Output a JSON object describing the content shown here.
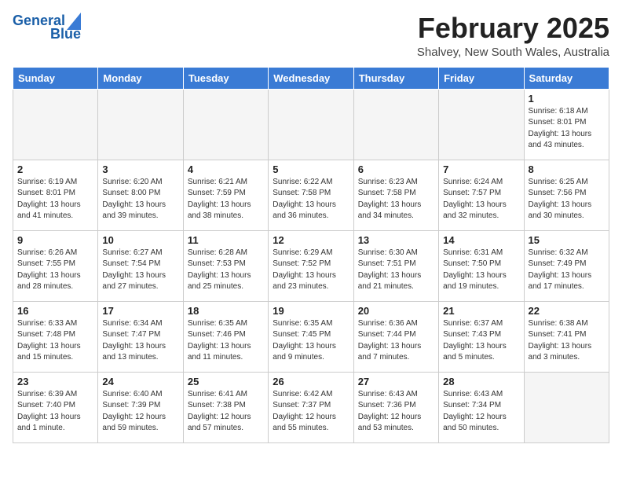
{
  "header": {
    "logo_line1": "General",
    "logo_line2": "Blue",
    "month": "February 2025",
    "location": "Shalvey, New South Wales, Australia"
  },
  "weekdays": [
    "Sunday",
    "Monday",
    "Tuesday",
    "Wednesday",
    "Thursday",
    "Friday",
    "Saturday"
  ],
  "weeks": [
    [
      {
        "day": "",
        "info": ""
      },
      {
        "day": "",
        "info": ""
      },
      {
        "day": "",
        "info": ""
      },
      {
        "day": "",
        "info": ""
      },
      {
        "day": "",
        "info": ""
      },
      {
        "day": "",
        "info": ""
      },
      {
        "day": "1",
        "info": "Sunrise: 6:18 AM\nSunset: 8:01 PM\nDaylight: 13 hours\nand 43 minutes."
      }
    ],
    [
      {
        "day": "2",
        "info": "Sunrise: 6:19 AM\nSunset: 8:01 PM\nDaylight: 13 hours\nand 41 minutes."
      },
      {
        "day": "3",
        "info": "Sunrise: 6:20 AM\nSunset: 8:00 PM\nDaylight: 13 hours\nand 39 minutes."
      },
      {
        "day": "4",
        "info": "Sunrise: 6:21 AM\nSunset: 7:59 PM\nDaylight: 13 hours\nand 38 minutes."
      },
      {
        "day": "5",
        "info": "Sunrise: 6:22 AM\nSunset: 7:58 PM\nDaylight: 13 hours\nand 36 minutes."
      },
      {
        "day": "6",
        "info": "Sunrise: 6:23 AM\nSunset: 7:58 PM\nDaylight: 13 hours\nand 34 minutes."
      },
      {
        "day": "7",
        "info": "Sunrise: 6:24 AM\nSunset: 7:57 PM\nDaylight: 13 hours\nand 32 minutes."
      },
      {
        "day": "8",
        "info": "Sunrise: 6:25 AM\nSunset: 7:56 PM\nDaylight: 13 hours\nand 30 minutes."
      }
    ],
    [
      {
        "day": "9",
        "info": "Sunrise: 6:26 AM\nSunset: 7:55 PM\nDaylight: 13 hours\nand 28 minutes."
      },
      {
        "day": "10",
        "info": "Sunrise: 6:27 AM\nSunset: 7:54 PM\nDaylight: 13 hours\nand 27 minutes."
      },
      {
        "day": "11",
        "info": "Sunrise: 6:28 AM\nSunset: 7:53 PM\nDaylight: 13 hours\nand 25 minutes."
      },
      {
        "day": "12",
        "info": "Sunrise: 6:29 AM\nSunset: 7:52 PM\nDaylight: 13 hours\nand 23 minutes."
      },
      {
        "day": "13",
        "info": "Sunrise: 6:30 AM\nSunset: 7:51 PM\nDaylight: 13 hours\nand 21 minutes."
      },
      {
        "day": "14",
        "info": "Sunrise: 6:31 AM\nSunset: 7:50 PM\nDaylight: 13 hours\nand 19 minutes."
      },
      {
        "day": "15",
        "info": "Sunrise: 6:32 AM\nSunset: 7:49 PM\nDaylight: 13 hours\nand 17 minutes."
      }
    ],
    [
      {
        "day": "16",
        "info": "Sunrise: 6:33 AM\nSunset: 7:48 PM\nDaylight: 13 hours\nand 15 minutes."
      },
      {
        "day": "17",
        "info": "Sunrise: 6:34 AM\nSunset: 7:47 PM\nDaylight: 13 hours\nand 13 minutes."
      },
      {
        "day": "18",
        "info": "Sunrise: 6:35 AM\nSunset: 7:46 PM\nDaylight: 13 hours\nand 11 minutes."
      },
      {
        "day": "19",
        "info": "Sunrise: 6:35 AM\nSunset: 7:45 PM\nDaylight: 13 hours\nand 9 minutes."
      },
      {
        "day": "20",
        "info": "Sunrise: 6:36 AM\nSunset: 7:44 PM\nDaylight: 13 hours\nand 7 minutes."
      },
      {
        "day": "21",
        "info": "Sunrise: 6:37 AM\nSunset: 7:43 PM\nDaylight: 13 hours\nand 5 minutes."
      },
      {
        "day": "22",
        "info": "Sunrise: 6:38 AM\nSunset: 7:41 PM\nDaylight: 13 hours\nand 3 minutes."
      }
    ],
    [
      {
        "day": "23",
        "info": "Sunrise: 6:39 AM\nSunset: 7:40 PM\nDaylight: 13 hours\nand 1 minute."
      },
      {
        "day": "24",
        "info": "Sunrise: 6:40 AM\nSunset: 7:39 PM\nDaylight: 12 hours\nand 59 minutes."
      },
      {
        "day": "25",
        "info": "Sunrise: 6:41 AM\nSunset: 7:38 PM\nDaylight: 12 hours\nand 57 minutes."
      },
      {
        "day": "26",
        "info": "Sunrise: 6:42 AM\nSunset: 7:37 PM\nDaylight: 12 hours\nand 55 minutes."
      },
      {
        "day": "27",
        "info": "Sunrise: 6:43 AM\nSunset: 7:36 PM\nDaylight: 12 hours\nand 53 minutes."
      },
      {
        "day": "28",
        "info": "Sunrise: 6:43 AM\nSunset: 7:34 PM\nDaylight: 12 hours\nand 50 minutes."
      },
      {
        "day": "",
        "info": ""
      }
    ]
  ]
}
